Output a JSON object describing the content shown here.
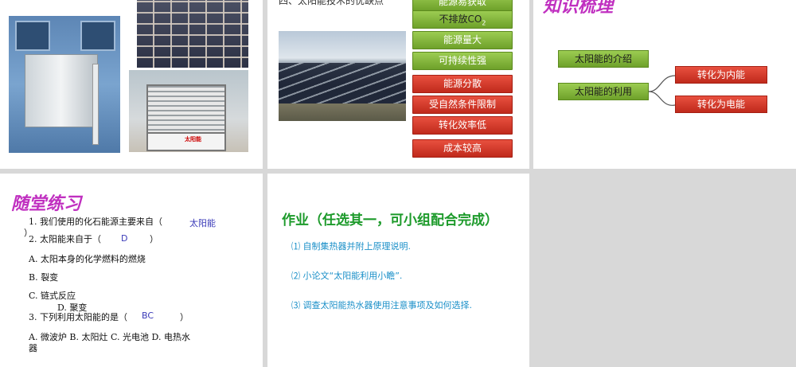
{
  "slide2": {
    "title_cut": "四、太阳能技术的优缺点",
    "advantages": [
      "能源易获取",
      "不排放CO",
      "能源量大",
      "可持续性强"
    ],
    "co2_subscript": "2",
    "disadvantages": [
      "能源分散",
      "受自然条件限制",
      "转化效率低",
      "成本较高"
    ]
  },
  "slide3": {
    "title": "知识梳理",
    "node_intro": "太阳能的介绍",
    "node_use": "太阳能的利用",
    "node_heat": "转化为内能",
    "node_elec": "转化为电能"
  },
  "slide4": {
    "title": "随堂练习",
    "q1": "1. 我们使用的化石能源主要来自（",
    "q1_answer": "太阳能",
    "q1_close": "）",
    "q2": "2. 太阳能来自于（",
    "q2_answer": "D",
    "q2_close": "）",
    "q2_optA": "A. 太阳本身的化学燃料的燃烧",
    "q2_optB": "B. 裂变",
    "q2_optC": "C. 链式反应",
    "q2_optD": "D. 聚变",
    "q3": "3. 下列利用太阳能的是（",
    "q3_answer": "BC",
    "q3_close": "）",
    "q3_opts": "A. 微波炉    B. 太阳灶    C. 光电池    D. 电热水",
    "q3_opts_wrap": "器"
  },
  "slide5": {
    "title": "作业（任选其一，可小组配合完成）",
    "items": [
      "⑴ 自制集热器并附上原理说明.",
      "⑵ 小论文“太阳能利用小瞻”.",
      "⑶ 调查太阳能热水器使用注意事项及如何选择."
    ]
  }
}
